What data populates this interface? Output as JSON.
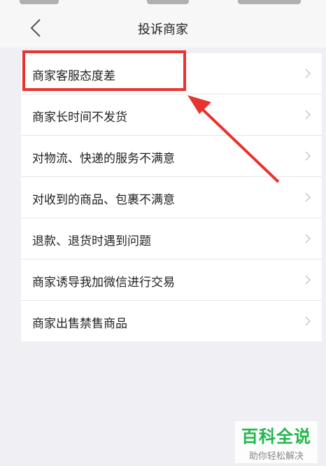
{
  "nav": {
    "title": "投诉商家",
    "back_icon": "chevron-left-icon"
  },
  "complaints": [
    {
      "label": "商家客服态度差"
    },
    {
      "label": "商家长时间不发货"
    },
    {
      "label": "对物流、快递的服务不满意"
    },
    {
      "label": "对收到的商品、包裹不满意"
    },
    {
      "label": "退款、退货时遇到问题"
    },
    {
      "label": "商家诱导我加微信进行交易"
    },
    {
      "label": "商家出售禁售商品"
    }
  ],
  "annotation": {
    "color": "#e8342f",
    "highlighted_item": "商家客服态度差"
  },
  "watermark": {
    "main": "百科全说",
    "sub": "助你轻松解决",
    "color": "#21b64b"
  }
}
